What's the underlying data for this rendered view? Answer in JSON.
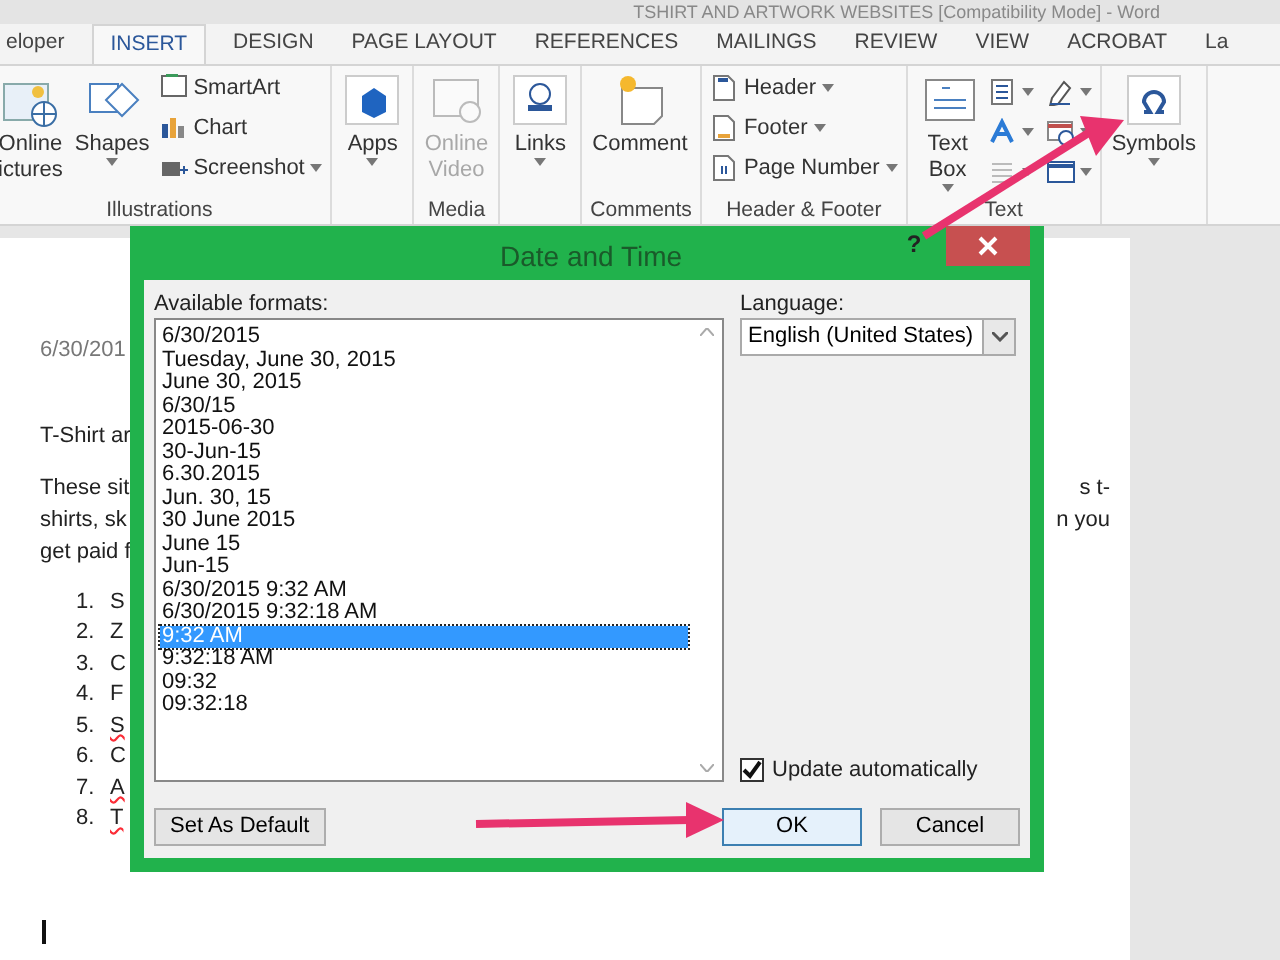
{
  "window": {
    "title": "TSHIRT AND ARTWORK WEBSITES [Compatibility Mode] - Word"
  },
  "tabs": [
    {
      "label": "eloper",
      "selected": false
    },
    {
      "label": "INSERT",
      "selected": true
    },
    {
      "label": "DESIGN",
      "selected": false
    },
    {
      "label": "PAGE LAYOUT",
      "selected": false
    },
    {
      "label": "REFERENCES",
      "selected": false
    },
    {
      "label": "MAILINGS",
      "selected": false
    },
    {
      "label": "REVIEW",
      "selected": false
    },
    {
      "label": "VIEW",
      "selected": false
    },
    {
      "label": "ACROBAT",
      "selected": false
    },
    {
      "label": "La",
      "selected": false
    }
  ],
  "ribbon": {
    "groups": [
      {
        "label": "Illustrations",
        "items": [
          {
            "kind": "large",
            "lines": [
              "Online",
              "ictures"
            ],
            "dropdown": false,
            "disabled": false
          },
          {
            "kind": "large",
            "lines": [
              "Shapes"
            ],
            "dropdown": true,
            "disabled": false
          },
          {
            "kind": "stack",
            "entries": [
              {
                "label": "SmartArt",
                "dropdown": false
              },
              {
                "label": "Chart",
                "dropdown": false
              },
              {
                "label": "Screenshot",
                "dropdown": true
              }
            ]
          }
        ]
      },
      {
        "items": [
          {
            "kind": "large",
            "lines": [
              "Apps"
            ],
            "dropdown": true,
            "disabled": false
          }
        ]
      },
      {
        "label": "Media",
        "items": [
          {
            "kind": "large",
            "lines": [
              "Online",
              "Video"
            ],
            "dropdown": false,
            "disabled": true
          }
        ]
      },
      {
        "items": [
          {
            "kind": "large",
            "lines": [
              "Links"
            ],
            "dropdown": true,
            "disabled": false
          }
        ]
      },
      {
        "label": "Comments",
        "items": [
          {
            "kind": "large",
            "lines": [
              "Comment"
            ],
            "dropdown": false,
            "disabled": false
          }
        ]
      },
      {
        "label": "Header & Footer",
        "items": [
          {
            "kind": "stack",
            "entries": [
              {
                "label": "Header",
                "dropdown": true
              },
              {
                "label": "Footer",
                "dropdown": true
              },
              {
                "label": "Page Number",
                "dropdown": true
              }
            ]
          }
        ]
      },
      {
        "label": "Text",
        "items": [
          {
            "kind": "large",
            "lines": [
              "Text",
              "Box"
            ],
            "dropdown": true,
            "disabled": false
          },
          {
            "kind": "icons"
          }
        ]
      },
      {
        "items": [
          {
            "kind": "large",
            "lines": [
              "Symbols"
            ],
            "dropdown": true,
            "disabled": false
          }
        ]
      }
    ]
  },
  "document": {
    "date_line": "6/30/201",
    "lines": [
      {
        "left": "T-Shirt ar"
      },
      {
        "left": "These sit",
        "right": "s t-"
      },
      {
        "left": "shirts, sk",
        "right": "n you"
      },
      {
        "left": "get paid f"
      }
    ],
    "list": [
      {
        "number": "1.",
        "text": "S",
        "misspelled": false
      },
      {
        "number": "2.",
        "text": "Z",
        "misspelled": false
      },
      {
        "number": "3.",
        "text": "C",
        "misspelled": false
      },
      {
        "number": "4.",
        "text": "F",
        "misspelled": false
      },
      {
        "number": "5.",
        "text": "S",
        "misspelled": true
      },
      {
        "number": "6.",
        "text": "C",
        "misspelled": false
      },
      {
        "number": "7.",
        "text": "A",
        "misspelled": true
      },
      {
        "number": "8.",
        "text": "T",
        "misspelled": true
      }
    ]
  },
  "dialog": {
    "title": "Date and Time",
    "help": "?",
    "formats_label": "Available formats:",
    "formats": [
      {
        "text": "6/30/2015",
        "selected": false
      },
      {
        "text": "Tuesday, June 30, 2015",
        "selected": false
      },
      {
        "text": "June 30, 2015",
        "selected": false
      },
      {
        "text": "6/30/15",
        "selected": false
      },
      {
        "text": "2015-06-30",
        "selected": false
      },
      {
        "text": "30-Jun-15",
        "selected": false
      },
      {
        "text": "6.30.2015",
        "selected": false
      },
      {
        "text": "Jun. 30, 15",
        "selected": false
      },
      {
        "text": "30 June 2015",
        "selected": false
      },
      {
        "text": "June 15",
        "selected": false
      },
      {
        "text": "Jun-15",
        "selected": false
      },
      {
        "text": "6/30/2015 9:32 AM",
        "selected": false
      },
      {
        "text": "6/30/2015 9:32:18 AM",
        "selected": false
      },
      {
        "text": "9:32 AM",
        "selected": true
      },
      {
        "text": "9:32:18 AM",
        "selected": false
      },
      {
        "text": "09:32",
        "selected": false
      },
      {
        "text": "09:32:18",
        "selected": false
      }
    ],
    "language_label": "Language:",
    "language": "English (United States)",
    "update_automatically": {
      "label": "Update automatically",
      "checked": true
    },
    "set_default_button": "Set As Default",
    "buttons": [
      {
        "label": "OK",
        "focused": true
      },
      {
        "label": "Cancel",
        "focused": false
      }
    ]
  }
}
